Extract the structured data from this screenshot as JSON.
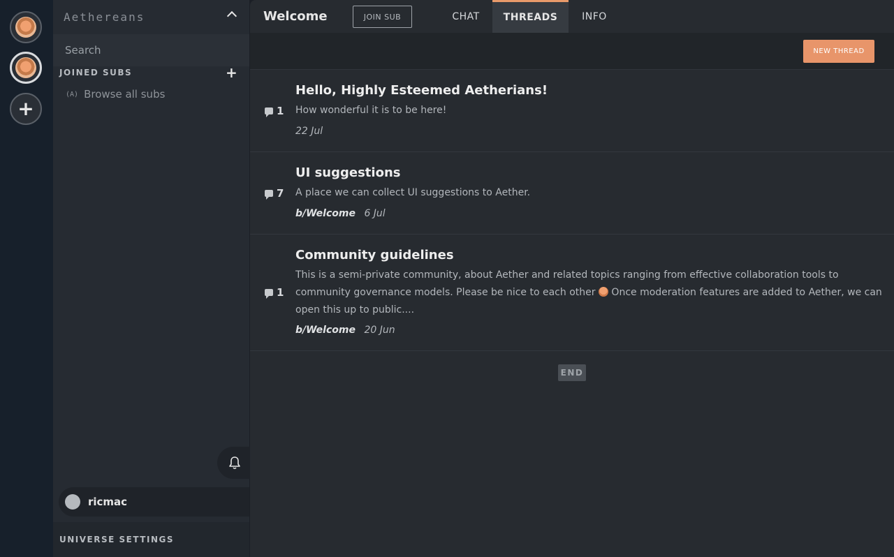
{
  "rail": {
    "servers": [
      {
        "name": "aethereans-server",
        "active": false
      },
      {
        "name": "aethereans-server-selected",
        "active": true
      }
    ],
    "add_label": "+"
  },
  "sidebar": {
    "title": "Aethereans",
    "search_placeholder": "Search",
    "joined_label": "JOINED SUBS",
    "joined_add": "+",
    "browse_label": "Browse all subs",
    "browse_icon_text": "(A)",
    "user": {
      "name": "ricmac"
    },
    "universe_settings": "UNIVERSE SETTINGS"
  },
  "header": {
    "title": "Welcome",
    "join_button": "JOIN SUB",
    "tabs": [
      {
        "label": "CHAT",
        "active": false
      },
      {
        "label": "THREADS",
        "active": true
      },
      {
        "label": "INFO",
        "active": false
      }
    ],
    "accent_color": "#e8956a"
  },
  "toolbar": {
    "new_thread": "NEW THREAD"
  },
  "threads": [
    {
      "count": "1",
      "title": "Hello, Highly Esteemed Aetherians!",
      "body": "How wonderful it is to be here!",
      "sub": "",
      "date": "22 Jul"
    },
    {
      "count": "7",
      "title": "UI suggestions",
      "body": "A place we can collect UI suggestions to Aether.",
      "sub": "b/Welcome",
      "date": "6 Jul"
    },
    {
      "count": "1",
      "title": "Community guidelines",
      "body_before_emoji": "This is a semi-private community, about Aether and related topics ranging from effective collaboration tools to community governance models. Please be nice to each other",
      "body_after_emoji": " Once moderation features are added to Aether, we can open this up to public....",
      "sub": "b/Welcome",
      "date": "20 Jun"
    }
  ],
  "end_label": "END"
}
